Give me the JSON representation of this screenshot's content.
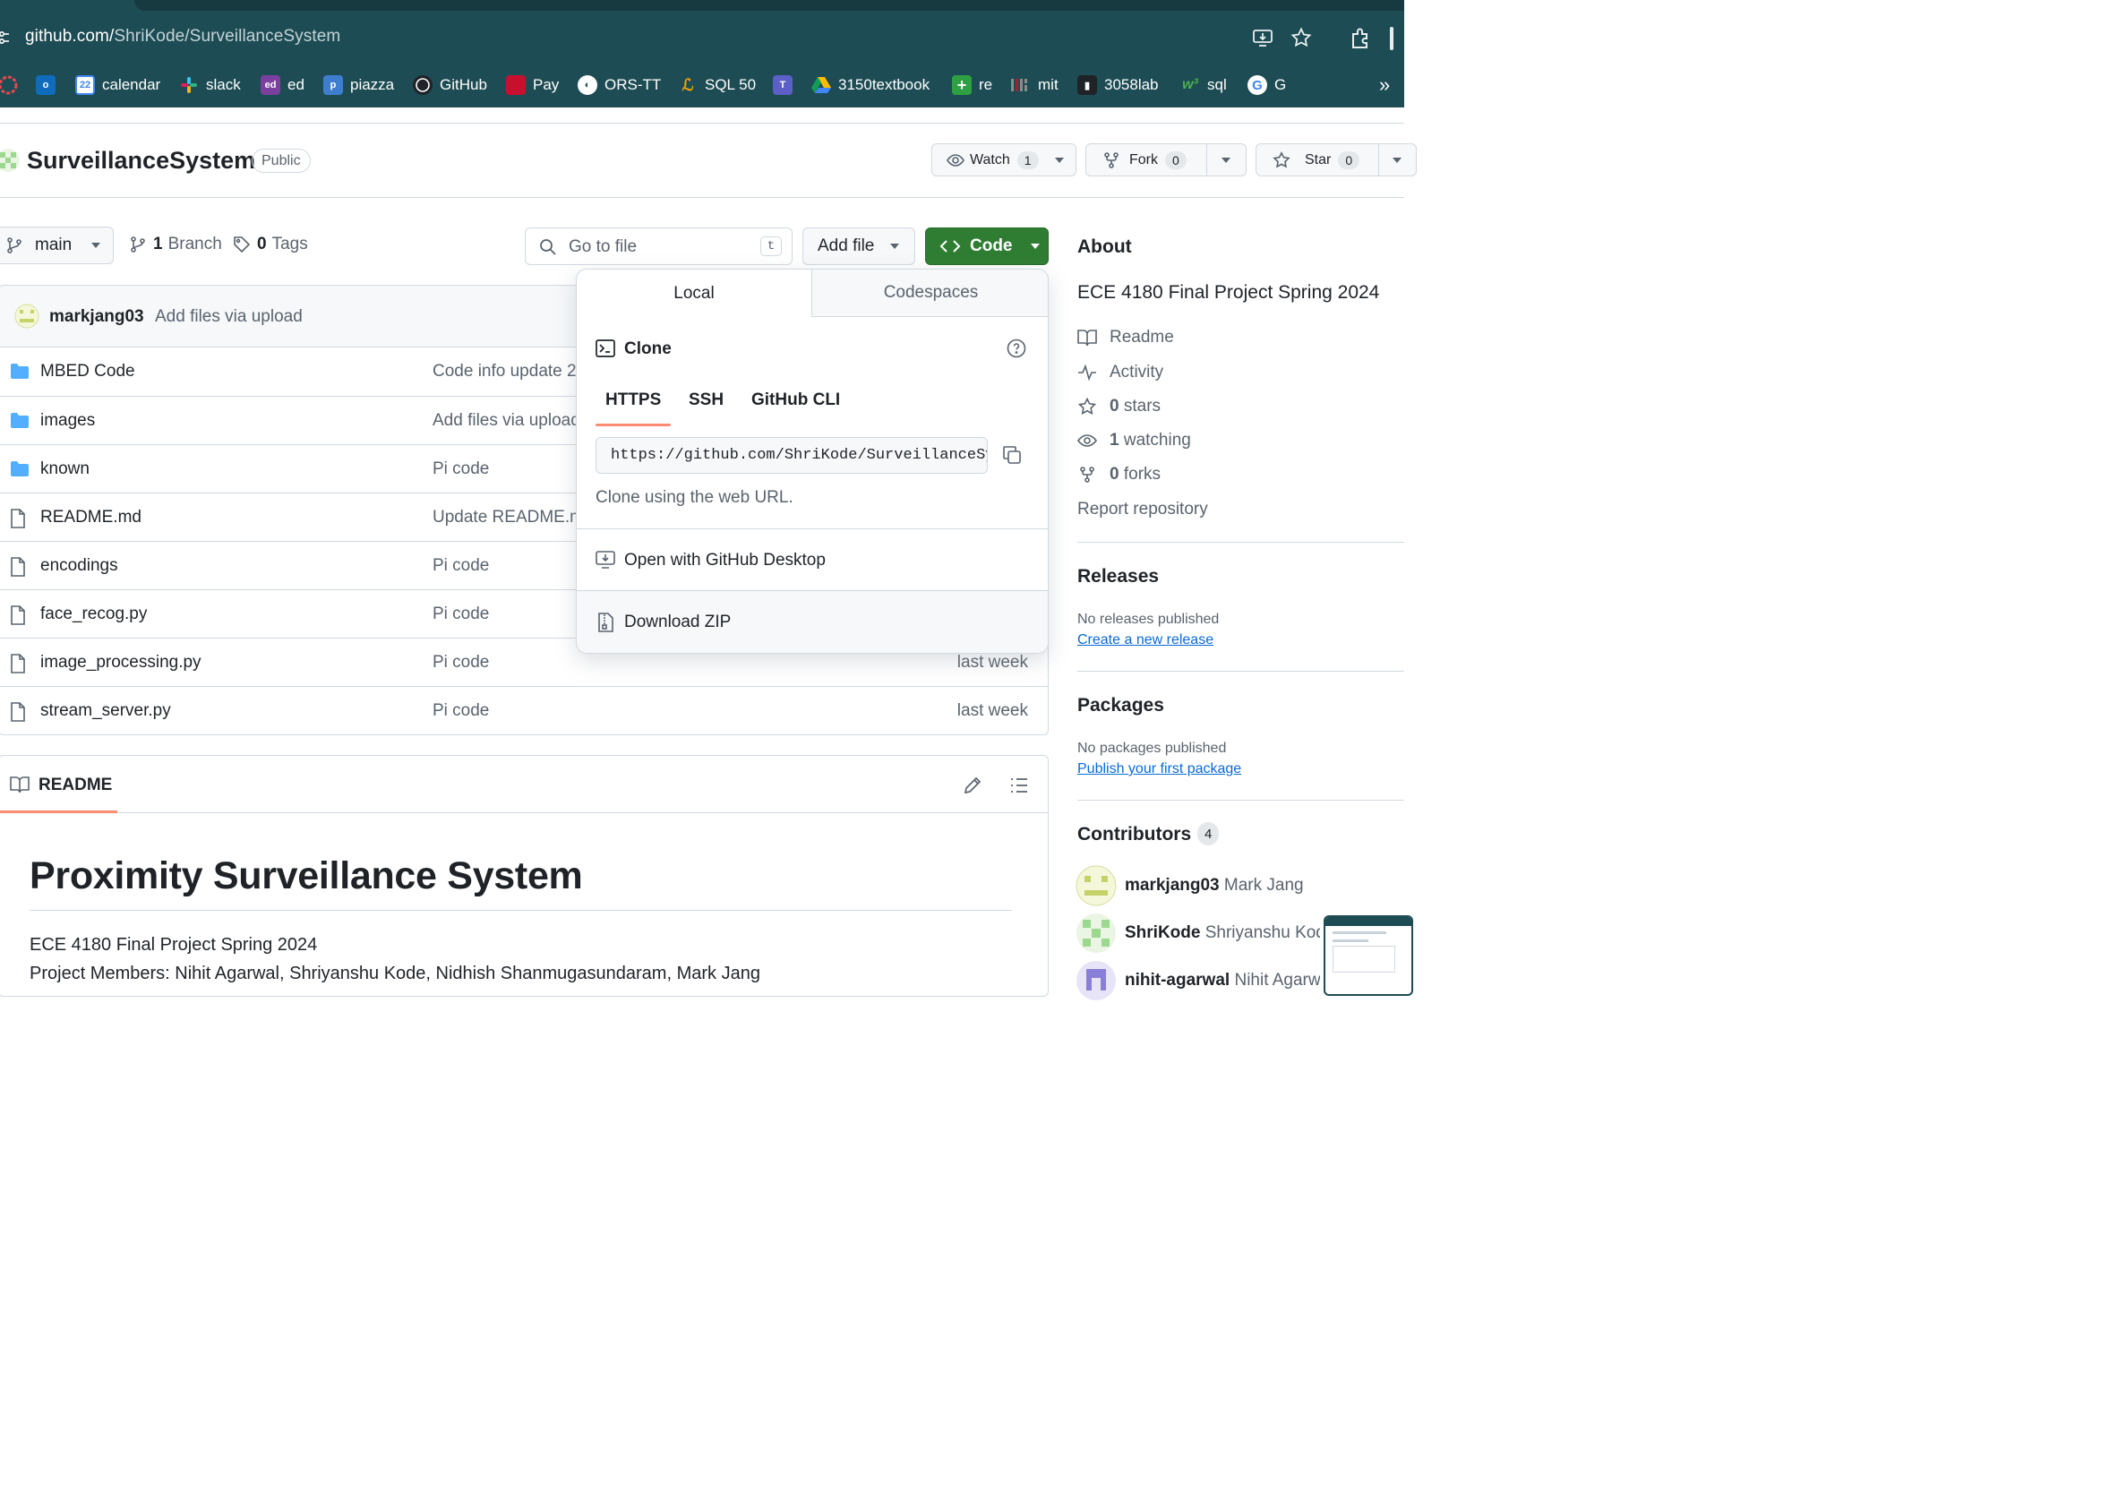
{
  "browser": {
    "url_host": "github.com/",
    "url_path": "ShriKode/SurveillanceSystem",
    "bookmarks": [
      {
        "label": "",
        "color": "#e5484d",
        "icon": "opera-icon"
      },
      {
        "label": "",
        "color": "#0f6cbd",
        "icon": "outlook-icon"
      },
      {
        "label": "calendar",
        "color": "#4285f4",
        "icon": "calendar-icon"
      },
      {
        "label": "slack",
        "color": "#611f69",
        "icon": "slack-icon"
      },
      {
        "label": "ed",
        "color": "#7b3fa0",
        "icon": "ed-icon"
      },
      {
        "label": "piazza",
        "color": "#3e7ecf",
        "icon": "piazza-icon"
      },
      {
        "label": "GitHub",
        "color": "#1f2328",
        "icon": "github-icon"
      },
      {
        "label": "Pay",
        "color": "#c8102e",
        "icon": "oracle-icon"
      },
      {
        "label": "ORS-TT",
        "color": "#ffffff",
        "icon": "globe-icon"
      },
      {
        "label": "SQL 50",
        "color": "#f0a300",
        "icon": "leetcode-icon"
      },
      {
        "label": "",
        "color": "#5b5fc7",
        "icon": "teams-icon"
      },
      {
        "label": "3150textbook",
        "color": "#0f9d58",
        "icon": "drive-icon"
      },
      {
        "label": "re",
        "color": "#2ea043",
        "icon": "plus-icon"
      },
      {
        "label": "mit",
        "color": "#a31f34",
        "icon": "mit-icon"
      },
      {
        "label": "3058lab",
        "color": "#1f2328",
        "icon": "book-icon"
      },
      {
        "label": "sql",
        "color": "#4caf50",
        "icon": "w3-icon"
      },
      {
        "label": "G",
        "color": "#ffffff",
        "icon": "google-icon"
      }
    ],
    "more_bookmarks": "»"
  },
  "repo": {
    "name": "SurveillanceSystem",
    "visibility": "Public",
    "watch_label": "Watch",
    "watch_count": "1",
    "fork_label": "Fork",
    "fork_count": "0",
    "star_label": "Star",
    "star_count": "0"
  },
  "toolbar": {
    "branch": "main",
    "branches_count": "1",
    "branches_label": "Branch",
    "tags_count": "0",
    "tags_label": "Tags",
    "go_to_file_placeholder": "Go to file",
    "go_to_file_key": "t",
    "add_file_label": "Add file",
    "code_label": "Code"
  },
  "commit": {
    "author": "markjang03",
    "message": "Add files via upload"
  },
  "files": [
    {
      "name": "MBED Code",
      "type": "folder",
      "message": "Code info update 2",
      "time": ""
    },
    {
      "name": "images",
      "type": "folder",
      "message": "Add files via upload",
      "time": ""
    },
    {
      "name": "known",
      "type": "folder",
      "message": "Pi code",
      "time": ""
    },
    {
      "name": "README.md",
      "type": "file",
      "message": "Update README.m",
      "time": ""
    },
    {
      "name": "encodings",
      "type": "file",
      "message": "Pi code",
      "time": ""
    },
    {
      "name": "face_recog.py",
      "type": "file",
      "message": "Pi code",
      "time": ""
    },
    {
      "name": "image_processing.py",
      "type": "file",
      "message": "Pi code",
      "time": "last week"
    },
    {
      "name": "stream_server.py",
      "type": "file",
      "message": "Pi code",
      "time": "last week"
    }
  ],
  "code_dropdown": {
    "tab_local": "Local",
    "tab_codespaces": "Codespaces",
    "clone_title": "Clone",
    "proto_https": "HTTPS",
    "proto_ssh": "SSH",
    "proto_cli": "GitHub CLI",
    "clone_url": "https://github.com/ShriKode/SurveillanceSystem.git",
    "clone_hint": "Clone using the web URL.",
    "open_desktop": "Open with GitHub Desktop",
    "download_zip": "Download ZIP"
  },
  "readme": {
    "tab_label": "README",
    "heading": "Proximity Surveillance System",
    "line1": "ECE 4180 Final Project Spring 2024",
    "line2": "Project Members: Nihit Agarwal, Shriyanshu Kode, Nidhish Shanmugasundaram, Mark Jang"
  },
  "about": {
    "title": "About",
    "description": "ECE 4180 Final Project Spring 2024",
    "readme": "Readme",
    "activity": "Activity",
    "stars_count": "0",
    "stars_label": "stars",
    "watching_count": "1",
    "watching_label": "watching",
    "forks_count": "0",
    "forks_label": "forks",
    "report": "Report repository"
  },
  "releases": {
    "title": "Releases",
    "empty": "No releases published",
    "create_link": "Create a new release"
  },
  "packages": {
    "title": "Packages",
    "empty": "No packages published",
    "publish_link": "Publish your first package"
  },
  "contributors": {
    "title": "Contributors",
    "count": "4",
    "items": [
      {
        "login": "markjang03",
        "name": "Mark Jang"
      },
      {
        "login": "ShriKode",
        "name": "Shriyanshu Kod"
      },
      {
        "login": "nihit-agarwal",
        "name": "Nihit Agarw"
      }
    ]
  },
  "colors": {
    "chrome_bg": "#1e4c54",
    "code_button": "#2f7d32",
    "link": "#0969da",
    "accent_underline": "#fd8c73"
  }
}
